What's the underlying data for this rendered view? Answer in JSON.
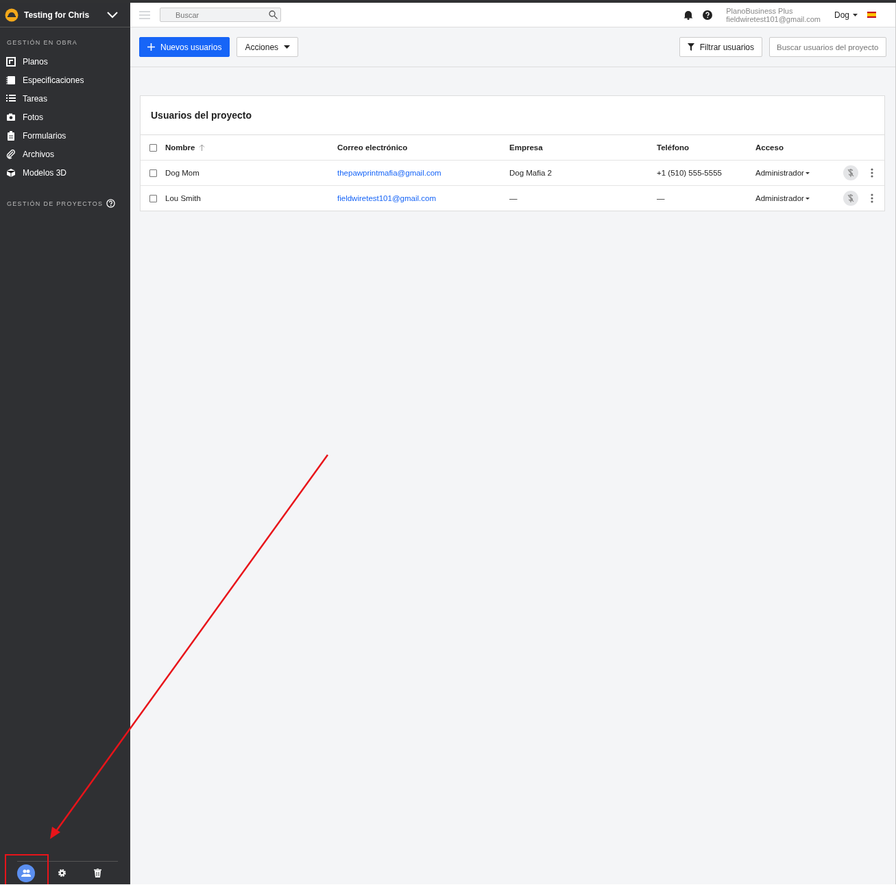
{
  "project": {
    "name": "Testing for Chris"
  },
  "sidebar": {
    "sections": [
      {
        "title": "GESTIÓN EN OBRA",
        "help": false,
        "items": [
          {
            "label": "Planos",
            "kind": "plans"
          },
          {
            "label": "Especificaciones",
            "kind": "specs"
          },
          {
            "label": "Tareas",
            "kind": "tasks"
          },
          {
            "label": "Fotos",
            "kind": "photos"
          },
          {
            "label": "Formularios",
            "kind": "forms"
          },
          {
            "label": "Archivos",
            "kind": "files"
          },
          {
            "label": "Modelos 3D",
            "kind": "models"
          }
        ]
      },
      {
        "title": "GESTIÓN DE PROYECTOS",
        "help": true
      }
    ],
    "footer": [
      {
        "kind": "users",
        "selected": true
      },
      {
        "kind": "settings",
        "selected": false
      },
      {
        "kind": "trash",
        "selected": false
      }
    ]
  },
  "topbar": {
    "search": {
      "placeholder": "Buscar"
    },
    "account": {
      "plan": "PlanoBusiness Plus",
      "email": "fieldwiretest101@gmail.com"
    },
    "user": "Dog"
  },
  "toolbar": {
    "new_button": "Nuevos usuarios",
    "actions_button": "Acciones",
    "filter_button": "Filtrar usuarios",
    "search": {
      "placeholder": "Buscar usuarios del proyecto"
    }
  },
  "table": {
    "title": "Usuarios del proyecto",
    "columns": [
      "Nombre",
      "Correo electrónico",
      "Empresa",
      "Teléfono",
      "Acceso"
    ],
    "all_checked": false,
    "rows": [
      {
        "checked": false,
        "name": "Dog Mom",
        "email": "thepawprintmafia@gmail.com",
        "company": "Dog Mafia 2",
        "phone": "+1 (510) 555-5555",
        "access": "Administrador"
      },
      {
        "checked": false,
        "name": "Lou Smith",
        "email": "fieldwiretest101@gmail.com",
        "company": "—",
        "phone": "—",
        "access": "Administrador"
      }
    ]
  },
  "annotations": [
    {
      "kind": "arrow"
    },
    {
      "kind": "highlight-box"
    }
  ]
}
